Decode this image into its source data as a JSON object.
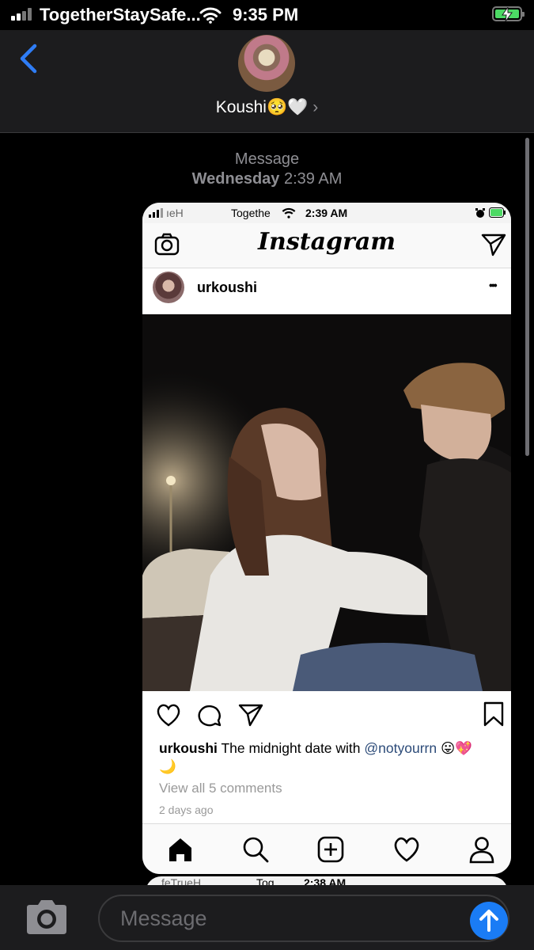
{
  "status_bar": {
    "carrier": "TogetherStaySafe...",
    "time": "9:35 PM"
  },
  "header": {
    "contact_name": "Koushi🥺🤍",
    "chevron": "›"
  },
  "thread": {
    "meta_label": "Message",
    "meta_day": "Wednesday",
    "meta_time": "2:39 AM"
  },
  "screenshot": {
    "status": {
      "carrier": "ıeH",
      "app": "Togethe",
      "time": "2:39 AM"
    },
    "app_name": "Instagram",
    "post": {
      "username": "urkoushi",
      "more": "•••",
      "caption_user": "urkoushi",
      "caption_text": "The midnight date with",
      "mention": "@notyourrn",
      "emojis": "😛💖",
      "emoji_line2": "🌙",
      "view_comments": "View all 5 comments",
      "posted": "2 days ago"
    }
  },
  "next_screenshot": {
    "carrier": "feTrueH",
    "app": "Tog",
    "time": "2:38 AM"
  },
  "composer": {
    "placeholder": "Message"
  },
  "colors": {
    "accent": "#1a7cf5",
    "battery": "#4cd964",
    "mention": "#2b4a78"
  }
}
